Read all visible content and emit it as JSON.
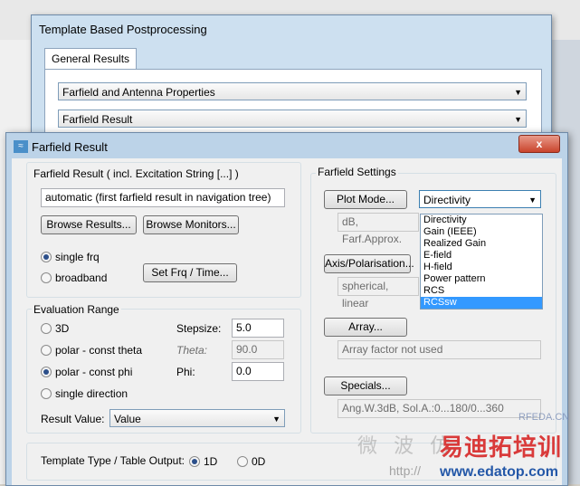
{
  "back_window": {
    "title": "Template Based Postprocessing",
    "tab": "General Results",
    "combo1": "Farfield and Antenna Properties",
    "combo2": "Farfield Result"
  },
  "front_window": {
    "title": "Farfield Result",
    "close": "x",
    "farfield_result_group": "Farfield Result ( incl. Excitation String [...] )",
    "farfield_result_value": "automatic (first farfield result in navigation tree)",
    "browse_results": "Browse Results...",
    "browse_monitors": "Browse Monitors...",
    "single_frq": "single frq",
    "broadband": "broadband",
    "set_frq_time": "Set Frq / Time...",
    "evaluation_range": "Evaluation Range",
    "opt_3d": "3D",
    "opt_polar_theta": "polar - const theta",
    "opt_polar_phi": "polar - const phi",
    "opt_single_dir": "single direction",
    "stepsize_label": "Stepsize:",
    "stepsize_value": "5.0",
    "theta_label": "Theta:",
    "theta_value": "90.0",
    "phi_label": "Phi:",
    "phi_value": "0.0",
    "result_value_label": "Result Value:",
    "result_value": "Value",
    "farfield_settings": "Farfield Settings",
    "plot_mode": "Plot Mode...",
    "plot_mode_value": "Directivity",
    "dbfarf": "dB, Farf.Approx.",
    "axis_polarisation": "Axis/Polarisation...",
    "spherical": "spherical, linear",
    "array": "Array...",
    "array_factor": "Array factor not used",
    "specials": "Specials...",
    "specials_value": "Ang.W.3dB, Sol.A.:0...180/0...360",
    "template_type": "Template Type / Table Output:",
    "opt_1d": "1D",
    "opt_0d": "0D",
    "dropdown_options": [
      "Directivity",
      "Gain (IEEE)",
      "Realized Gain",
      "E-field",
      "H-field",
      "Power pattern",
      "RCS",
      "RCSsw"
    ]
  },
  "watermark": {
    "cn1": "微 波 仿",
    "cn2": "易迪拓培训",
    "url": "http://",
    "site": "www.edatop.com",
    "rfeda": "RFEDA.CN"
  },
  "colors": {
    "selection": "#3399ff",
    "title_bar": "#bcd3e8",
    "close_button": "#c9442c"
  }
}
